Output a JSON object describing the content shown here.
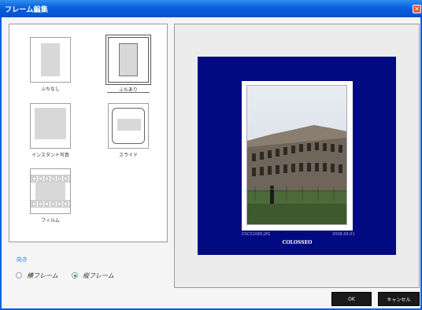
{
  "window": {
    "title": "フレーム編集",
    "close_glyph": "✕"
  },
  "frames": [
    {
      "label": "ふちなし"
    },
    {
      "label": "ふちあり",
      "selected": true
    },
    {
      "label": "インスタント写真"
    },
    {
      "label": "スライド"
    },
    {
      "label": "フィルム"
    }
  ],
  "orientation": {
    "label": "向き",
    "options": [
      {
        "label": "横フレーム",
        "checked": false
      },
      {
        "label": "縦フレーム",
        "checked": true
      }
    ]
  },
  "preview": {
    "background_color": "#020a82",
    "file_name": "DSC01085.JPG",
    "date": "2008.04.01",
    "caption": "COLOSSEO"
  },
  "buttons": {
    "ok": "OK",
    "cancel": "キャンセル"
  }
}
